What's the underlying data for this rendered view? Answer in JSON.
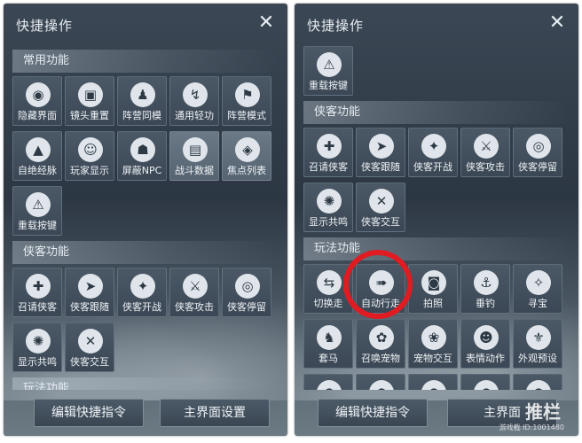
{
  "left": {
    "title": "快捷操作",
    "sections": [
      {
        "header": "常用功能",
        "rows": [
          [
            {
              "label": "隐藏界面",
              "icon": "eye-icon"
            },
            {
              "label": "镜头重置",
              "icon": "camera-icon"
            },
            {
              "label": "阵营同模",
              "icon": "people-icon"
            },
            {
              "label": "通用轻功",
              "icon": "leap-icon"
            },
            {
              "label": "阵营模式",
              "icon": "banner-icon"
            }
          ],
          [
            {
              "label": "自绝经脉",
              "icon": "hat-icon"
            },
            {
              "label": "玩家显示",
              "icon": "player-icon"
            },
            {
              "label": "屏蔽NPC",
              "icon": "npc-icon"
            },
            {
              "label": "战斗数据",
              "icon": "chart-icon",
              "hl": true
            },
            {
              "label": "焦点列表",
              "icon": "focus-icon",
              "hl": true
            }
          ],
          [
            {
              "label": "重载按键",
              "icon": "warning-icon"
            }
          ]
        ]
      },
      {
        "header": "侠客功能",
        "rows": [
          [
            {
              "label": "召请侠客",
              "icon": "summon-icon"
            },
            {
              "label": "侠客跟随",
              "icon": "follow-icon"
            },
            {
              "label": "侠客开战",
              "icon": "fight-icon"
            },
            {
              "label": "侠客攻击",
              "icon": "attack-icon"
            },
            {
              "label": "侠客停留",
              "icon": "stay-icon"
            }
          ],
          [
            {
              "label": "显示共鸣",
              "icon": "resonance-icon"
            },
            {
              "label": "侠客交互",
              "icon": "interact-icon"
            }
          ]
        ]
      },
      {
        "header": "玩法功能",
        "rows": []
      }
    ],
    "buttons": [
      "编辑快捷指令",
      "主界面设置"
    ]
  },
  "right": {
    "title": "快捷操作",
    "sections": [
      {
        "header": "",
        "rows": [
          [
            {
              "label": "重载按键",
              "icon": "warning-icon"
            }
          ]
        ]
      },
      {
        "header": "侠客功能",
        "rows": [
          [
            {
              "label": "召请侠客",
              "icon": "summon-icon"
            },
            {
              "label": "侠客跟随",
              "icon": "follow-icon"
            },
            {
              "label": "侠客开战",
              "icon": "fight-icon"
            },
            {
              "label": "侠客攻击",
              "icon": "attack-icon"
            },
            {
              "label": "侠客停留",
              "icon": "stay-icon"
            }
          ],
          [
            {
              "label": "显示共鸣",
              "icon": "resonance-icon"
            },
            {
              "label": "侠客交互",
              "icon": "interact-icon"
            }
          ]
        ]
      },
      {
        "header": "玩法功能",
        "rows": [
          [
            {
              "label": "切换走",
              "icon": "walk-icon"
            },
            {
              "label": "自动行走",
              "icon": "auto-walk-icon"
            },
            {
              "label": "拍照",
              "icon": "photo-icon"
            },
            {
              "label": "垂钓",
              "icon": "fish-icon"
            },
            {
              "label": "寻宝",
              "icon": "treasure-icon"
            }
          ],
          [
            {
              "label": "套马",
              "icon": "horse-icon"
            },
            {
              "label": "召唤宠物",
              "icon": "pet-icon"
            },
            {
              "label": "宠物交互",
              "icon": "pet-interact-icon"
            },
            {
              "label": "表情动作",
              "icon": "emote-icon"
            },
            {
              "label": "外观预设",
              "icon": "outfit-icon"
            }
          ],
          [
            {
              "label": "",
              "icon": "more-icon"
            },
            {
              "label": "",
              "icon": "more-icon"
            },
            {
              "label": "",
              "icon": "more-icon"
            },
            {
              "label": "",
              "icon": "more-icon"
            },
            {
              "label": "",
              "icon": "more-icon"
            }
          ]
        ]
      }
    ],
    "buttons": [
      "编辑快捷指令",
      "主界面"
    ],
    "watermark": "游戏截 ID:1001480",
    "watermark_big": "推栏"
  },
  "icon_glyphs": {
    "eye-icon": "◉",
    "camera-icon": "▣",
    "people-icon": "♟",
    "leap-icon": "↯",
    "banner-icon": "⚑",
    "hat-icon": "▲",
    "player-icon": "☺",
    "npc-icon": "☗",
    "chart-icon": "▤",
    "focus-icon": "◈",
    "warning-icon": "⚠",
    "summon-icon": "✚",
    "follow-icon": "➤",
    "fight-icon": "✦",
    "attack-icon": "⚔",
    "stay-icon": "◎",
    "resonance-icon": "✺",
    "interact-icon": "✕",
    "walk-icon": "⇆",
    "auto-walk-icon": "➠",
    "photo-icon": "◙",
    "fish-icon": "⚓",
    "treasure-icon": "✧",
    "horse-icon": "♞",
    "pet-icon": "✿",
    "pet-interact-icon": "❀",
    "emote-icon": "☻",
    "outfit-icon": "⚜",
    "more-icon": "●"
  },
  "colors": {
    "highlight": "#e11b22"
  }
}
